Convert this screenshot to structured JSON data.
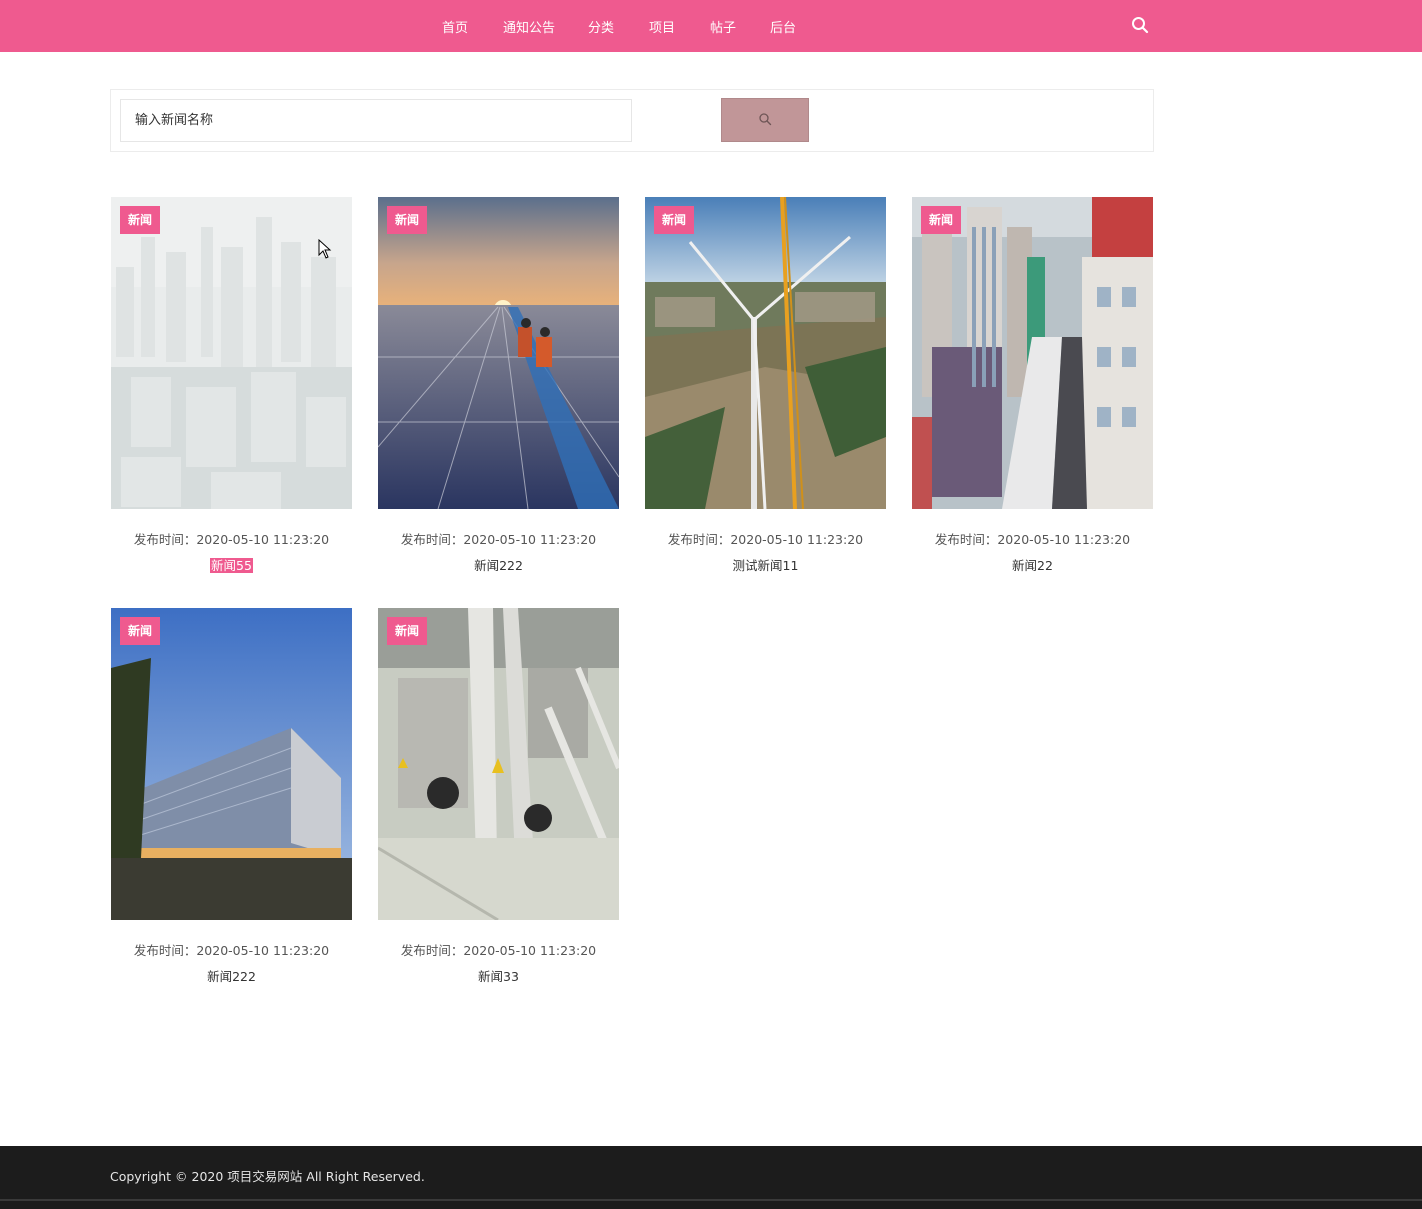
{
  "nav": {
    "items": [
      {
        "label": "首页"
      },
      {
        "label": "通知公告"
      },
      {
        "label": "分类"
      },
      {
        "label": "项目"
      },
      {
        "label": "帖子"
      },
      {
        "label": "后台"
      }
    ],
    "search_icon": "search-icon"
  },
  "search": {
    "placeholder": "输入新闻名称",
    "button_icon": "search-icon"
  },
  "cards": [
    {
      "tag": "新闻",
      "time": "发布时间：2020-05-10 11:23:20",
      "title": "新闻55",
      "image": "faded-city-skyline"
    },
    {
      "tag": "新闻",
      "time": "发布时间：2020-05-10 11:23:20",
      "title": "新闻222",
      "image": "solar-panels-sunset"
    },
    {
      "tag": "新闻",
      "time": "发布时间：2020-05-10 11:23:20",
      "title": "测试新闻11",
      "image": "wind-turbine-construction"
    },
    {
      "tag": "新闻",
      "time": "发布时间：2020-05-10 11:23:20",
      "title": "新闻22",
      "image": "city-street-aerial"
    },
    {
      "tag": "新闻",
      "time": "发布时间：2020-05-10 11:23:20",
      "title": "新闻222",
      "image": "glass-office-building"
    },
    {
      "tag": "新闻",
      "time": "发布时间：2020-05-10 11:23:20",
      "title": "新闻33",
      "image": "factory-machinery"
    }
  ],
  "footer": {
    "copyright": "Copyright © 2020 项目交易网站 All Right Reserved."
  },
  "colors": {
    "brand": "#ef5a8f",
    "search_button": "#c19698",
    "footer_bg": "#1c1c1c"
  }
}
